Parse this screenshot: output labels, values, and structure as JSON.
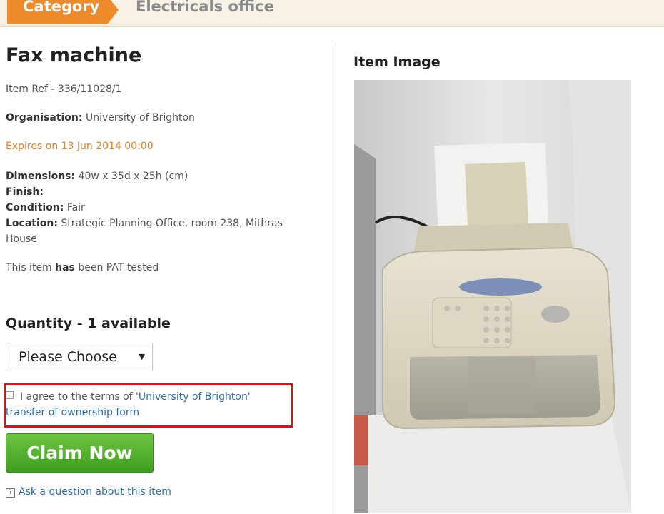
{
  "category": {
    "tab_label": "Category",
    "value": "Electricals office"
  },
  "item": {
    "title": "Fax machine",
    "ref": "Item Ref - 336/11028/1",
    "organisation_label": "Organisation:",
    "organisation_value": "University of Brighton",
    "expires": "Expires on 13 Jun 2014 00:00",
    "dimensions_label": "Dimensions:",
    "dimensions_value": "40w x 35d x 25h (cm)",
    "finish_label": "Finish:",
    "finish_value": "",
    "condition_label": "Condition:",
    "condition_value": "Fair",
    "location_label": "Location:",
    "location_value": "Strategic Planning Office, room 238, Mithras House",
    "pat_prefix": "This item ",
    "pat_bold": "has",
    "pat_suffix": " been PAT tested"
  },
  "claim_form": {
    "quantity_heading": "Quantity - 1 available",
    "quantity_select": "Please Choose",
    "agree_prefix": "I agree to the terms of ",
    "agree_link": "'University of Brighton' transfer of ownership form",
    "agree_checked": false,
    "claim_button": "Claim Now",
    "ask_link": "Ask a question about this item"
  },
  "image_panel": {
    "heading": "Item Image",
    "image_subject": "fax-machine-photo"
  },
  "colors": {
    "accent_orange": "#ee8a2a",
    "expires_text": "#ee7a22",
    "link_blue": "#2e6fae",
    "highlight_red": "#e01010",
    "claim_green": "#4faf2a"
  }
}
